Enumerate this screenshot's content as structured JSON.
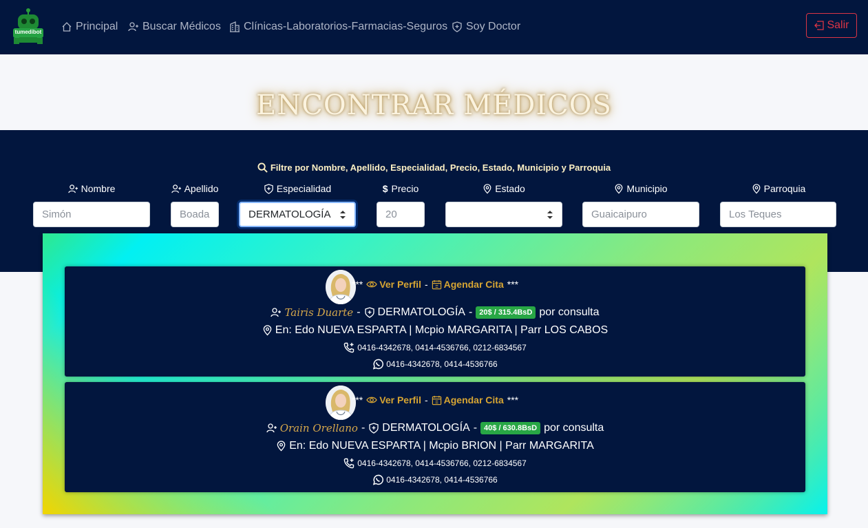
{
  "navbar": {
    "logo_text": "tumedibot",
    "items": [
      {
        "label": "Principal",
        "icon": "house-icon"
      },
      {
        "label": "Buscar Médicos",
        "icon": "person-plus-icon"
      },
      {
        "label": "Clínicas-Laboratorios-Farmacias-Seguros",
        "icon": "building-icon"
      },
      {
        "label": "Soy Doctor",
        "icon": "shield-icon"
      }
    ],
    "logout_label": "Salir"
  },
  "hero": {
    "title": "ENCONTRAR MÉDICOS"
  },
  "filters": {
    "heading": "Filtre por Nombre, Apellido, Especialidad, Precio, Estado, Municipio y Parroquia",
    "fields": [
      {
        "label": "Nombre",
        "icon": "person-plus-icon",
        "placeholder": "Simón",
        "value": ""
      },
      {
        "label": "Apellido",
        "icon": "person-plus-icon",
        "placeholder": "Boada",
        "value": ""
      },
      {
        "label": "Especialidad",
        "icon": "shield-plus-icon",
        "value": "DERMATOLOGÍA"
      },
      {
        "label": "Precio",
        "icon": "dollar-icon",
        "placeholder": "20",
        "value": ""
      },
      {
        "label": "Estado",
        "icon": "geo-pin-icon",
        "value": ""
      },
      {
        "label": "Municipio",
        "icon": "geo-pin-icon",
        "placeholder": "Guaicaipuro",
        "value": ""
      },
      {
        "label": "Parroquia",
        "icon": "geo-pin-icon",
        "placeholder": "Los Teques",
        "value": ""
      }
    ]
  },
  "results": [
    {
      "stars_left": "***",
      "view_profile": "Ver Perfil",
      "schedule": "Agendar Cita",
      "stars_right": "***",
      "name": "Tairis Duarte",
      "specialty": "DERMATOLOGÍA",
      "price": "20$ / 315.4BsD",
      "per": "por consulta",
      "location": "En: Edo NUEVA ESPARTA | Mcpio MARGARITA | Parr LOS CABOS",
      "phones": "0416-4342678, 0414-4536766, 0212-6834567",
      "whatsapp": "0416-4342678, 0414-4536766"
    },
    {
      "stars_left": "***",
      "view_profile": "Ver Perfil",
      "schedule": "Agendar Cita",
      "stars_right": "***",
      "name": "Orain Orellano",
      "specialty": "DERMATOLOGÍA",
      "price": "40$ / 630.8BsD",
      "per": "por consulta",
      "location": "En: Edo NUEVA ESPARTA | Mcpio BRION | Parr MARGARITA",
      "phones": "0416-4342678, 0414-4536766, 0212-6834567",
      "whatsapp": "0416-4342678, 0414-4536766"
    }
  ],
  "colors": {
    "navy": "#02163e",
    "gold": "#d7a533",
    "badge_green": "#28a745",
    "danger": "#dc3545"
  }
}
